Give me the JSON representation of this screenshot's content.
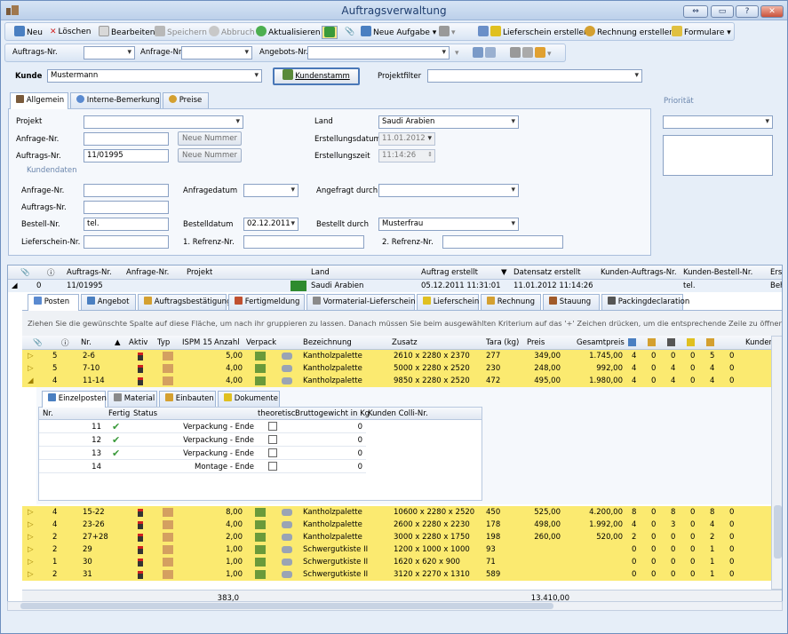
{
  "window": {
    "title": "Auftragsverwaltung"
  },
  "toolbar": {
    "neu": "Neu",
    "loeschen": "Löschen",
    "bearbeiten": "Bearbeiten",
    "speichern": "Speichern",
    "abbruch": "Abbruch",
    "aktualisieren": "Aktualisieren",
    "neue_aufgabe": "Neue Aufgabe",
    "lieferschein": "Lieferschein erstellen",
    "rechnung": "Rechnung erstellen",
    "formulare": "Formulare"
  },
  "search": {
    "auftrags_nr": "Auftrags-Nr.",
    "anfrage_nr": "Anfrage-Nr.",
    "angebots_nr": "Angebots-Nr."
  },
  "kunde": {
    "label": "Kunde",
    "value": "Mustermann",
    "kundenstamm": "Kundenstamm",
    "projektfilter": "Projektfilter"
  },
  "tabs": [
    "Allgemein",
    "Interne-Bemerkung",
    "Preise"
  ],
  "form": {
    "projekt": "Projekt",
    "anfrage_nr": "Anfrage-Nr.",
    "auftrags_nr": "Auftrags-Nr.",
    "auftrags_nr_value": "11/01995",
    "neue_nummer": "Neue Nummer",
    "land": "Land",
    "land_value": "Saudi Arabien",
    "erstellungsdatum": "Erstellungsdatum",
    "erstellungsdatum_value": "11.01.2012",
    "erstellungszeit": "Erstellungszeit",
    "erstellungszeit_value": "11:14:26"
  },
  "kundendaten": {
    "title": "Kundendaten",
    "anfrage_nr": "Anfrage-Nr.",
    "auftrags_nr": "Auftrags-Nr.",
    "bestell_nr": "Bestell-Nr.",
    "bestell_nr_value": "tel.",
    "lieferschein_nr": "Lieferschein-Nr.",
    "anfragedatum": "Anfragedatum",
    "bestelldatum": "Bestelldatum",
    "bestelldatum_value": "02.12.2011",
    "referenz1": "1. Refrenz-Nr.",
    "angefragt_durch": "Angefragt durch",
    "bestellt_durch": "Bestellt durch",
    "bestellt_durch_value": "Musterfrau",
    "referenz2": "2. Refrenz-Nr."
  },
  "prioritaet": {
    "label": "Priorität"
  },
  "main_grid": {
    "headers": [
      "Auftrags-Nr.",
      "Anfrage-Nr.",
      "Projekt",
      "Land",
      "Auftrag erstellt",
      "Datensatz erstellt",
      "Kunden-Auftrags-Nr.",
      "Kunden-Bestell-Nr.",
      "Erst"
    ],
    "row": {
      "count": "0",
      "auftrags_nr": "11/01995",
      "land": "Saudi Arabien",
      "auftrag_erstellt": "05.12.2011 11:31:01",
      "datensatz_erstellt": "11.01.2012 11:14:26",
      "bestell_nr": "tel.",
      "last": "Beh"
    }
  },
  "sub_tabs": [
    "Posten",
    "Angebot",
    "Auftragsbestätigung",
    "Fertigmeldung",
    "Vormaterial-Lieferschein",
    "Lieferschein",
    "Rechnung",
    "Stauung",
    "Packingdeclaration"
  ],
  "group_hint": "Ziehen Sie die gewünschte Spalte auf diese Fläche, um nach ihr gruppieren zu lassen. Danach müssen Sie beim ausgewählten Kriterium auf das '+' Zeichen drücken, um die entsprechende Zeile zu öffnen.",
  "posten_headers": [
    "Nr.",
    "Aktiv",
    "Typ",
    "ISPM 15",
    "Anzahl",
    "Verpack",
    "Bezeichnung",
    "Zusatz",
    "Tara (kg)",
    "Preis",
    "Gesamtpreis",
    "Kunden"
  ],
  "posten_rows_top": [
    {
      "g": "5",
      "nr": "2-6",
      "anzahl": "5,00",
      "bez": "Kantholzpalette",
      "zusatz": "2610 x 2280 x 2370",
      "tara": "277",
      "preis": "349,00",
      "gesamt": "1.745,00",
      "n": [
        "4",
        "0",
        "0",
        "0",
        "5",
        "0"
      ]
    },
    {
      "g": "5",
      "nr": "7-10",
      "anzahl": "4,00",
      "bez": "Kantholzpalette",
      "zusatz": "5000 x 2280 x 2520",
      "tara": "230",
      "preis": "248,00",
      "gesamt": "992,00",
      "n": [
        "4",
        "0",
        "4",
        "0",
        "4",
        "0"
      ]
    },
    {
      "g": "4",
      "nr": "11-14",
      "anzahl": "4,00",
      "bez": "Kantholzpalette",
      "zusatz": "9850 x 2280 x 2520",
      "tara": "472",
      "preis": "495,00",
      "gesamt": "1.980,00",
      "n": [
        "4",
        "0",
        "4",
        "0",
        "4",
        "0"
      ]
    }
  ],
  "detail_tabs": [
    "Einzelposten",
    "Material",
    "Einbauten",
    "Dokumente"
  ],
  "detail_headers": [
    "Nr.",
    "Fertig",
    "Status",
    "theoretisc",
    "Bruttogewicht in Kg",
    "Kunden Colli-Nr."
  ],
  "detail_rows": [
    {
      "nr": "11",
      "status": "Verpackung - Ende",
      "brutto": "0"
    },
    {
      "nr": "12",
      "status": "Verpackung - Ende",
      "brutto": "0"
    },
    {
      "nr": "13",
      "status": "Verpackung - Ende",
      "brutto": "0"
    },
    {
      "nr": "14",
      "status": "Montage - Ende",
      "brutto": "0"
    }
  ],
  "posten_rows_bottom": [
    {
      "g": "4",
      "nr": "15-22",
      "anzahl": "8,00",
      "bez": "Kantholzpalette",
      "zusatz": "10600 x 2280 x 2520",
      "tara": "450",
      "preis": "525,00",
      "gesamt": "4.200,00",
      "n": [
        "8",
        "0",
        "8",
        "0",
        "8",
        "0"
      ]
    },
    {
      "g": "4",
      "nr": "23-26",
      "anzahl": "4,00",
      "bez": "Kantholzpalette",
      "zusatz": "2600 x 2280 x 2230",
      "tara": "178",
      "preis": "498,00",
      "gesamt": "1.992,00",
      "n": [
        "4",
        "0",
        "3",
        "0",
        "4",
        "0"
      ]
    },
    {
      "g": "2",
      "nr": "27+28",
      "anzahl": "2,00",
      "bez": "Kantholzpalette",
      "zusatz": "3000 x 2280 x 1750",
      "tara": "198",
      "preis": "260,00",
      "gesamt": "520,00",
      "n": [
        "2",
        "0",
        "0",
        "0",
        "2",
        "0"
      ]
    },
    {
      "g": "2",
      "nr": "29",
      "anzahl": "1,00",
      "bez": "Schwergutkiste II",
      "zusatz": "1200 x 1000 x 1000",
      "tara": "93",
      "preis": "",
      "gesamt": "",
      "n": [
        "0",
        "0",
        "0",
        "0",
        "1",
        "0"
      ]
    },
    {
      "g": "1",
      "nr": "30",
      "anzahl": "1,00",
      "bez": "Schwergutkiste II",
      "zusatz": "1620 x 620 x 900",
      "tara": "71",
      "preis": "",
      "gesamt": "",
      "n": [
        "0",
        "0",
        "0",
        "0",
        "1",
        "0"
      ]
    },
    {
      "g": "2",
      "nr": "31",
      "anzahl": "1,00",
      "bez": "Schwergutkiste II",
      "zusatz": "3120 x 2270 x 1310",
      "tara": "589",
      "preis": "",
      "gesamt": "",
      "n": [
        "0",
        "0",
        "0",
        "0",
        "1",
        "0"
      ]
    }
  ],
  "totals": {
    "anzahl": "383,0",
    "gesamt": "13.410,00"
  }
}
